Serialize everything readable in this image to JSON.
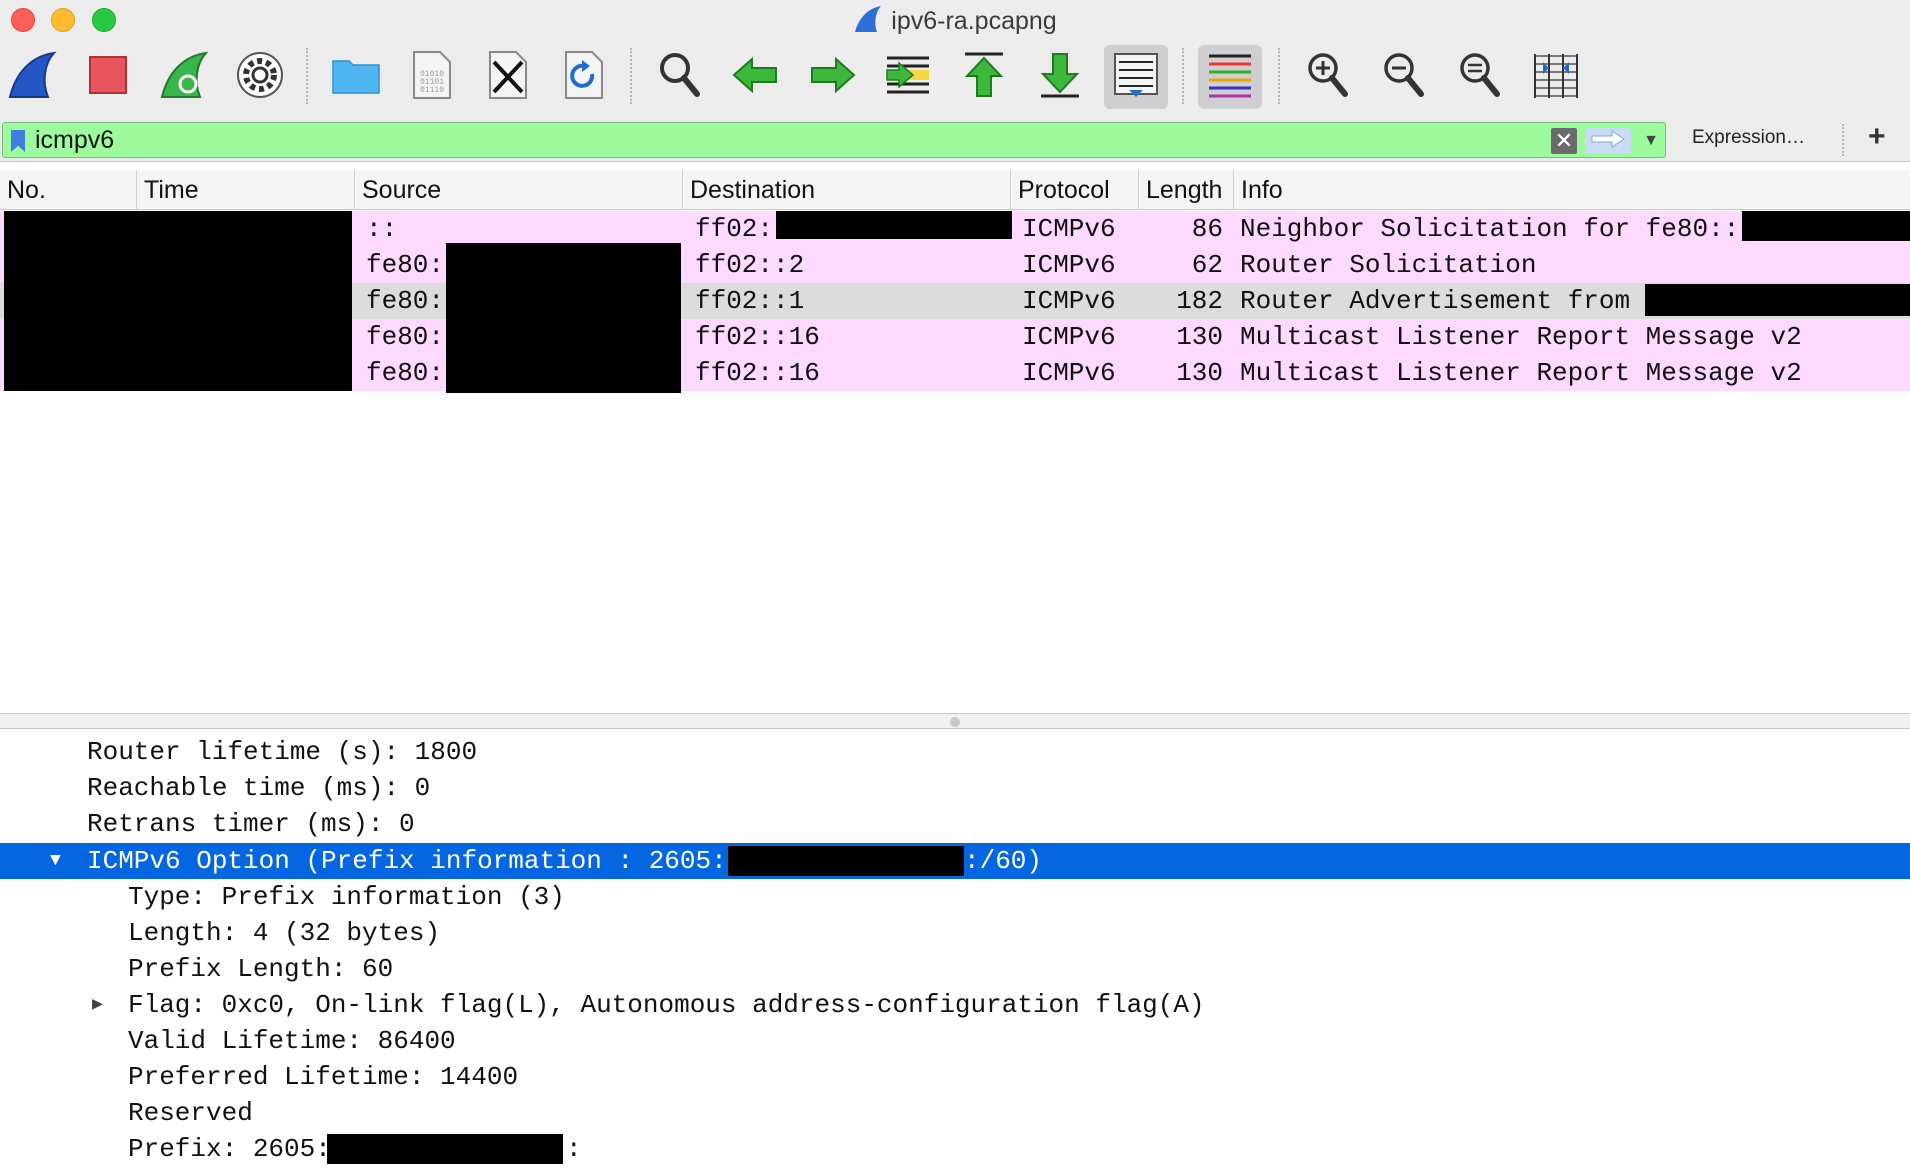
{
  "window": {
    "title": "ipv6-ra.pcapng"
  },
  "toolbar": {
    "buttons": [
      {
        "name": "start-capture-button",
        "icon": "shark-fin-icon"
      },
      {
        "name": "stop-capture-button",
        "icon": "stop-square-icon"
      },
      {
        "name": "restart-capture-button",
        "icon": "restart-fin-icon"
      },
      {
        "name": "capture-options-button",
        "icon": "gear-icon"
      },
      {
        "name": "open-file-button",
        "icon": "folder-icon"
      },
      {
        "name": "save-file-button",
        "icon": "binary-file-icon"
      },
      {
        "name": "close-file-button",
        "icon": "close-file-icon"
      },
      {
        "name": "reload-file-button",
        "icon": "reload-file-icon"
      },
      {
        "name": "find-packet-button",
        "icon": "magnifier-icon"
      },
      {
        "name": "go-back-button",
        "icon": "arrow-left-icon"
      },
      {
        "name": "go-forward-button",
        "icon": "arrow-right-icon"
      },
      {
        "name": "go-to-packet-button",
        "icon": "goto-packet-icon"
      },
      {
        "name": "first-packet-button",
        "icon": "arrow-up-bar-icon"
      },
      {
        "name": "last-packet-button",
        "icon": "arrow-down-bar-icon"
      },
      {
        "name": "auto-scroll-button",
        "icon": "auto-scroll-icon"
      },
      {
        "name": "colorize-button",
        "icon": "colorize-lines-icon"
      },
      {
        "name": "zoom-in-button",
        "icon": "zoom-in-icon"
      },
      {
        "name": "zoom-out-button",
        "icon": "zoom-out-icon"
      },
      {
        "name": "normal-size-button",
        "icon": "zoom-reset-icon"
      },
      {
        "name": "resize-columns-button",
        "icon": "resize-columns-icon"
      }
    ]
  },
  "filter": {
    "value": "icmpv6",
    "background_color": "#9cfb9c",
    "expression_label": "Expression…",
    "add_label": "+"
  },
  "packet_list": {
    "columns": [
      "No.",
      "Time",
      "Source",
      "Destination",
      "Protocol",
      "Length",
      "Info"
    ],
    "rows": [
      {
        "source": "::",
        "destination": "ff02:",
        "protocol": "ICMPv6",
        "length": "86",
        "info": "Neighbor Solicitation for fe80::"
      },
      {
        "source": "fe80:",
        "destination": "ff02::2",
        "protocol": "ICMPv6",
        "length": "62",
        "info": "Router Solicitation"
      },
      {
        "source": "fe80:",
        "destination": "ff02::1",
        "protocol": "ICMPv6",
        "length": "182",
        "info": "Router Advertisement from"
      },
      {
        "source": "fe80:",
        "destination": "ff02::16",
        "protocol": "ICMPv6",
        "length": "130",
        "info": "Multicast Listener Report Message v2"
      },
      {
        "source": "fe80:",
        "destination": "ff02::16",
        "protocol": "ICMPv6",
        "length": "130",
        "info": "Multicast Listener Report Message v2"
      }
    ],
    "row_color": "#fdd9fd",
    "selected_row_color": "#dcdcdc"
  },
  "details": {
    "lines": [
      {
        "text": "Router lifetime (s): 1800"
      },
      {
        "text": "Reachable time (ms): 0"
      },
      {
        "text": "Retrans timer (ms): 0"
      },
      {
        "text": "ICMPv6 Option (Prefix information : 2605:",
        "suffix": ":/60)"
      },
      {
        "text": "Type: Prefix information (3)"
      },
      {
        "text": "Length: 4 (32 bytes)"
      },
      {
        "text": "Prefix Length: 60"
      },
      {
        "text": "Flag: 0xc0, On-link flag(L), Autonomous address-configuration flag(A)"
      },
      {
        "text": "Valid Lifetime: 86400"
      },
      {
        "text": "Preferred Lifetime: 14400"
      },
      {
        "text": "Reserved"
      },
      {
        "text": "Prefix: 2605:",
        "suffix": ":"
      }
    ],
    "selected_color": "#0466e0"
  }
}
